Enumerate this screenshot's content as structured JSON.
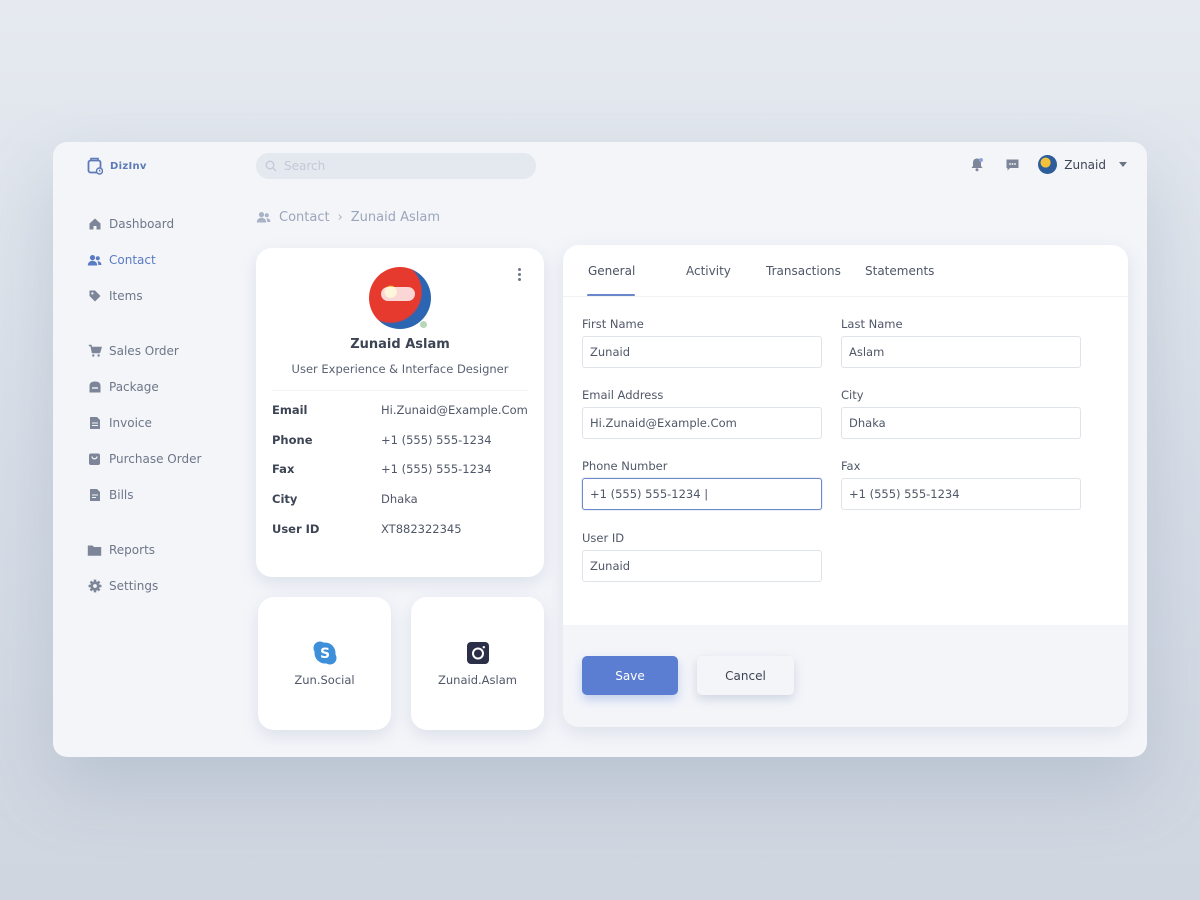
{
  "app": {
    "name": "DizInv"
  },
  "search": {
    "placeholder": "Search",
    "value": ""
  },
  "user": {
    "name": "Zunaid"
  },
  "sidebar": {
    "items": [
      {
        "label": "Dashboard",
        "icon": "home-icon",
        "active": false
      },
      {
        "label": "Contact",
        "icon": "users-icon",
        "active": true
      },
      {
        "label": "Items",
        "icon": "tag-icon",
        "active": false
      },
      {
        "label": "Sales Order",
        "icon": "cart-icon",
        "active": false
      },
      {
        "label": "Package",
        "icon": "package-icon",
        "active": false
      },
      {
        "label": "Invoice",
        "icon": "invoice-icon",
        "active": false
      },
      {
        "label": "Purchase Order",
        "icon": "bag-icon",
        "active": false
      },
      {
        "label": "Bills",
        "icon": "bills-icon",
        "active": false
      },
      {
        "label": "Reports",
        "icon": "folder-icon",
        "active": false
      },
      {
        "label": "Settings",
        "icon": "gear-icon",
        "active": false
      }
    ]
  },
  "breadcrumb": {
    "section": "Contact",
    "current": "Zunaid Aslam"
  },
  "profile": {
    "name": "Zunaid Aslam",
    "role": "User Experience & Interface Designer",
    "status_color": "#b8d7b6",
    "info": [
      {
        "key": "Email",
        "value": "Hi.Zunaid@Example.Com"
      },
      {
        "key": "Phone",
        "value": "+1 (555) 555-1234"
      },
      {
        "key": "Fax",
        "value": "+1 (555) 555-1234"
      },
      {
        "key": "City",
        "value": "Dhaka"
      },
      {
        "key": "User ID",
        "value": "XT882322345"
      }
    ]
  },
  "social": [
    {
      "label": "Zun.Social",
      "icon": "skype-icon"
    },
    {
      "label": "Zunaid.Aslam",
      "icon": "instagram-icon"
    }
  ],
  "tabs": [
    {
      "label": "General",
      "active": true
    },
    {
      "label": "Activity",
      "active": false
    },
    {
      "label": "Transactions",
      "active": false
    },
    {
      "label": "Statements",
      "active": false
    }
  ],
  "form": {
    "first_name": {
      "label": "First Name",
      "value": "Zunaid"
    },
    "last_name": {
      "label": "Last Name",
      "value": "Aslam"
    },
    "email": {
      "label": "Email Address",
      "value": "Hi.Zunaid@Example.Com"
    },
    "city": {
      "label": "City",
      "value": "Dhaka"
    },
    "phone": {
      "label": "Phone Number",
      "value": "+1 (555) 555-1234 |"
    },
    "fax": {
      "label": "Fax",
      "value": "+1 (555) 555-1234"
    },
    "user_id": {
      "label": "User ID",
      "value": "Zunaid"
    }
  },
  "buttons": {
    "save": "Save",
    "cancel": "Cancel"
  },
  "colors": {
    "accent": "#5b7ed3",
    "active_nav": "#5a7bc4",
    "background": "#f3f5f9"
  }
}
